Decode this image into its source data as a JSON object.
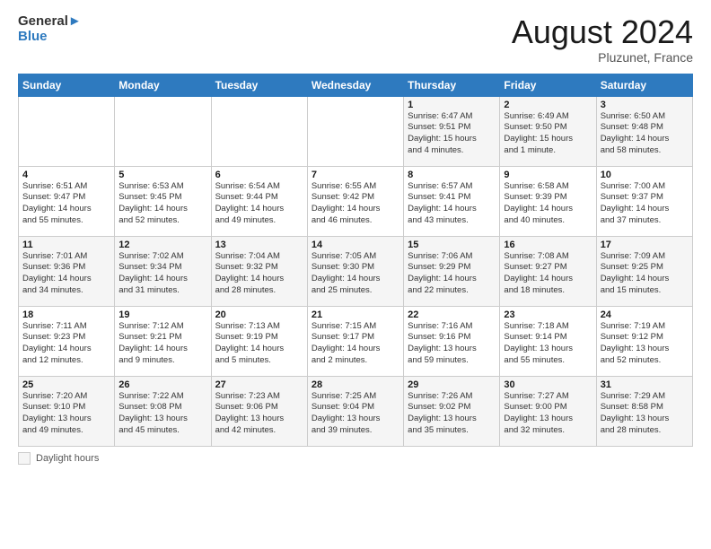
{
  "header": {
    "logo_line1": "General",
    "logo_line2": "Blue",
    "month": "August 2024",
    "location": "Pluzunet, France"
  },
  "footer": {
    "label": "Daylight hours"
  },
  "weekdays": [
    "Sunday",
    "Monday",
    "Tuesday",
    "Wednesday",
    "Thursday",
    "Friday",
    "Saturday"
  ],
  "weeks": [
    [
      {
        "day": "",
        "info": ""
      },
      {
        "day": "",
        "info": ""
      },
      {
        "day": "",
        "info": ""
      },
      {
        "day": "",
        "info": ""
      },
      {
        "day": "1",
        "info": "Sunrise: 6:47 AM\nSunset: 9:51 PM\nDaylight: 15 hours\nand 4 minutes."
      },
      {
        "day": "2",
        "info": "Sunrise: 6:49 AM\nSunset: 9:50 PM\nDaylight: 15 hours\nand 1 minute."
      },
      {
        "day": "3",
        "info": "Sunrise: 6:50 AM\nSunset: 9:48 PM\nDaylight: 14 hours\nand 58 minutes."
      }
    ],
    [
      {
        "day": "4",
        "info": "Sunrise: 6:51 AM\nSunset: 9:47 PM\nDaylight: 14 hours\nand 55 minutes."
      },
      {
        "day": "5",
        "info": "Sunrise: 6:53 AM\nSunset: 9:45 PM\nDaylight: 14 hours\nand 52 minutes."
      },
      {
        "day": "6",
        "info": "Sunrise: 6:54 AM\nSunset: 9:44 PM\nDaylight: 14 hours\nand 49 minutes."
      },
      {
        "day": "7",
        "info": "Sunrise: 6:55 AM\nSunset: 9:42 PM\nDaylight: 14 hours\nand 46 minutes."
      },
      {
        "day": "8",
        "info": "Sunrise: 6:57 AM\nSunset: 9:41 PM\nDaylight: 14 hours\nand 43 minutes."
      },
      {
        "day": "9",
        "info": "Sunrise: 6:58 AM\nSunset: 9:39 PM\nDaylight: 14 hours\nand 40 minutes."
      },
      {
        "day": "10",
        "info": "Sunrise: 7:00 AM\nSunset: 9:37 PM\nDaylight: 14 hours\nand 37 minutes."
      }
    ],
    [
      {
        "day": "11",
        "info": "Sunrise: 7:01 AM\nSunset: 9:36 PM\nDaylight: 14 hours\nand 34 minutes."
      },
      {
        "day": "12",
        "info": "Sunrise: 7:02 AM\nSunset: 9:34 PM\nDaylight: 14 hours\nand 31 minutes."
      },
      {
        "day": "13",
        "info": "Sunrise: 7:04 AM\nSunset: 9:32 PM\nDaylight: 14 hours\nand 28 minutes."
      },
      {
        "day": "14",
        "info": "Sunrise: 7:05 AM\nSunset: 9:30 PM\nDaylight: 14 hours\nand 25 minutes."
      },
      {
        "day": "15",
        "info": "Sunrise: 7:06 AM\nSunset: 9:29 PM\nDaylight: 14 hours\nand 22 minutes."
      },
      {
        "day": "16",
        "info": "Sunrise: 7:08 AM\nSunset: 9:27 PM\nDaylight: 14 hours\nand 18 minutes."
      },
      {
        "day": "17",
        "info": "Sunrise: 7:09 AM\nSunset: 9:25 PM\nDaylight: 14 hours\nand 15 minutes."
      }
    ],
    [
      {
        "day": "18",
        "info": "Sunrise: 7:11 AM\nSunset: 9:23 PM\nDaylight: 14 hours\nand 12 minutes."
      },
      {
        "day": "19",
        "info": "Sunrise: 7:12 AM\nSunset: 9:21 PM\nDaylight: 14 hours\nand 9 minutes."
      },
      {
        "day": "20",
        "info": "Sunrise: 7:13 AM\nSunset: 9:19 PM\nDaylight: 14 hours\nand 5 minutes."
      },
      {
        "day": "21",
        "info": "Sunrise: 7:15 AM\nSunset: 9:17 PM\nDaylight: 14 hours\nand 2 minutes."
      },
      {
        "day": "22",
        "info": "Sunrise: 7:16 AM\nSunset: 9:16 PM\nDaylight: 13 hours\nand 59 minutes."
      },
      {
        "day": "23",
        "info": "Sunrise: 7:18 AM\nSunset: 9:14 PM\nDaylight: 13 hours\nand 55 minutes."
      },
      {
        "day": "24",
        "info": "Sunrise: 7:19 AM\nSunset: 9:12 PM\nDaylight: 13 hours\nand 52 minutes."
      }
    ],
    [
      {
        "day": "25",
        "info": "Sunrise: 7:20 AM\nSunset: 9:10 PM\nDaylight: 13 hours\nand 49 minutes."
      },
      {
        "day": "26",
        "info": "Sunrise: 7:22 AM\nSunset: 9:08 PM\nDaylight: 13 hours\nand 45 minutes."
      },
      {
        "day": "27",
        "info": "Sunrise: 7:23 AM\nSunset: 9:06 PM\nDaylight: 13 hours\nand 42 minutes."
      },
      {
        "day": "28",
        "info": "Sunrise: 7:25 AM\nSunset: 9:04 PM\nDaylight: 13 hours\nand 39 minutes."
      },
      {
        "day": "29",
        "info": "Sunrise: 7:26 AM\nSunset: 9:02 PM\nDaylight: 13 hours\nand 35 minutes."
      },
      {
        "day": "30",
        "info": "Sunrise: 7:27 AM\nSunset: 9:00 PM\nDaylight: 13 hours\nand 32 minutes."
      },
      {
        "day": "31",
        "info": "Sunrise: 7:29 AM\nSunset: 8:58 PM\nDaylight: 13 hours\nand 28 minutes."
      }
    ]
  ]
}
